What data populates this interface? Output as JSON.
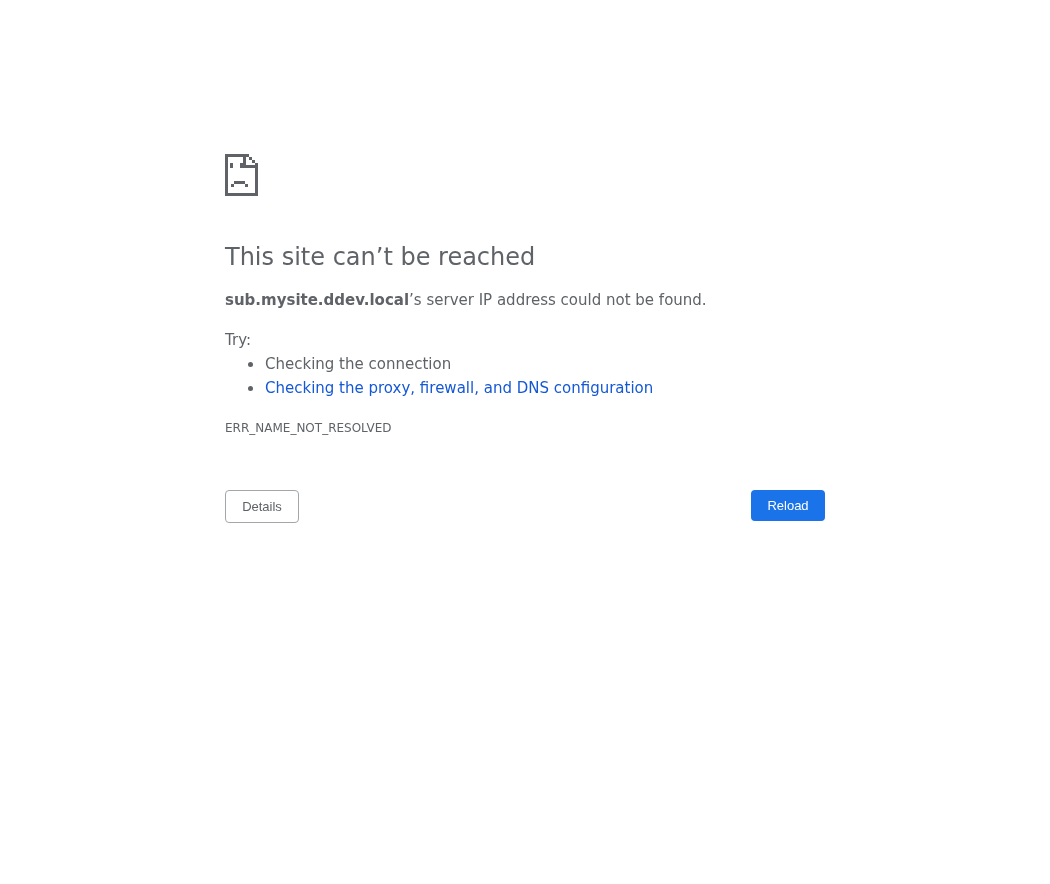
{
  "heading": "This site can’t be reached",
  "summary": "**sub.mysite.ddev.local**’s server IP address could not be found.",
  "suggestions": {
    "label": "Try:",
    "items": [
      {
        "text": "Checking the connection",
        "kind": "text"
      },
      {
        "text": "Checking the proxy, firewall, and DNS configuration",
        "kind": "link"
      }
    ]
  },
  "error_code": "ERR_NAME_NOT_RESOLVED",
  "buttons": [
    {
      "label": "Details",
      "kind": "secondary"
    },
    {
      "label": "Reload",
      "kind": "primary"
    }
  ]
}
